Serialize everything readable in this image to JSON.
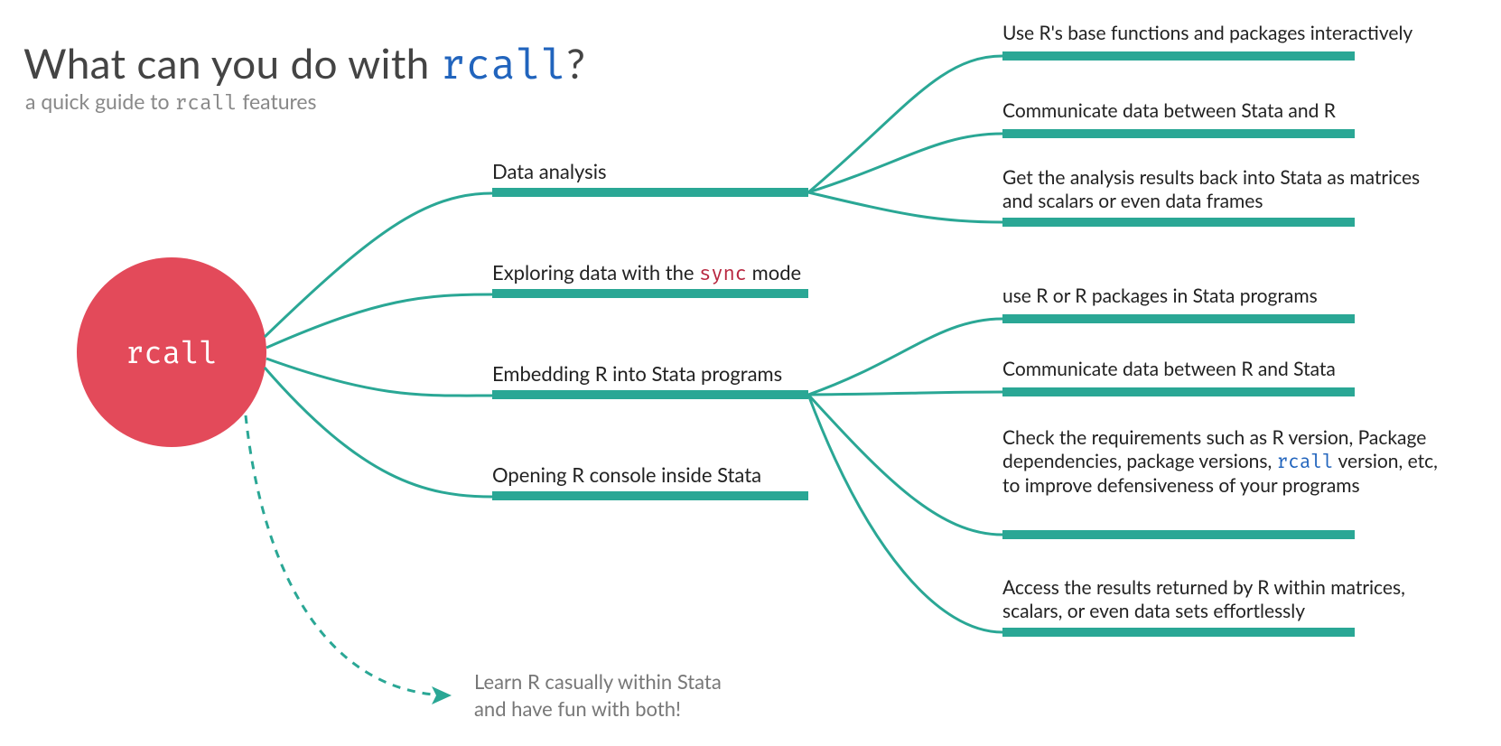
{
  "title_pre": "What can you do with ",
  "title_code": "rcall",
  "title_post": "?",
  "subtitle_pre": "a quick guide to ",
  "subtitle_code": "rcall",
  "subtitle_post": " features",
  "root": "rcall",
  "branches": {
    "b1": {
      "label": "Data analysis"
    },
    "b2": {
      "label_pre": "Exploring data with the ",
      "label_code": "sync",
      "label_post": " mode"
    },
    "b3": {
      "label": "Embedding R into Stata programs"
    },
    "b4": {
      "label": "Opening R console inside Stata"
    }
  },
  "leaves_b1": {
    "l1": "Use R's base functions and packages interactively",
    "l2": "Communicate data between Stata and R",
    "l3": "Get the analysis results back into Stata as matrices and scalars or even data frames"
  },
  "leaves_b3": {
    "l1": "use R or R packages in Stata programs",
    "l2": "Communicate data between R and Stata",
    "l3_pre": "Check the requirements such as R version, Package dependencies, package versions, ",
    "l3_code": "rcall",
    "l3_post": " version, etc, to improve defensiveness of your programs",
    "l4": "Access the results returned by R within matrices, scalars, or even data sets effortlessly"
  },
  "tip_line1": "Learn R casually within Stata",
  "tip_line2": "and have fun with both!"
}
